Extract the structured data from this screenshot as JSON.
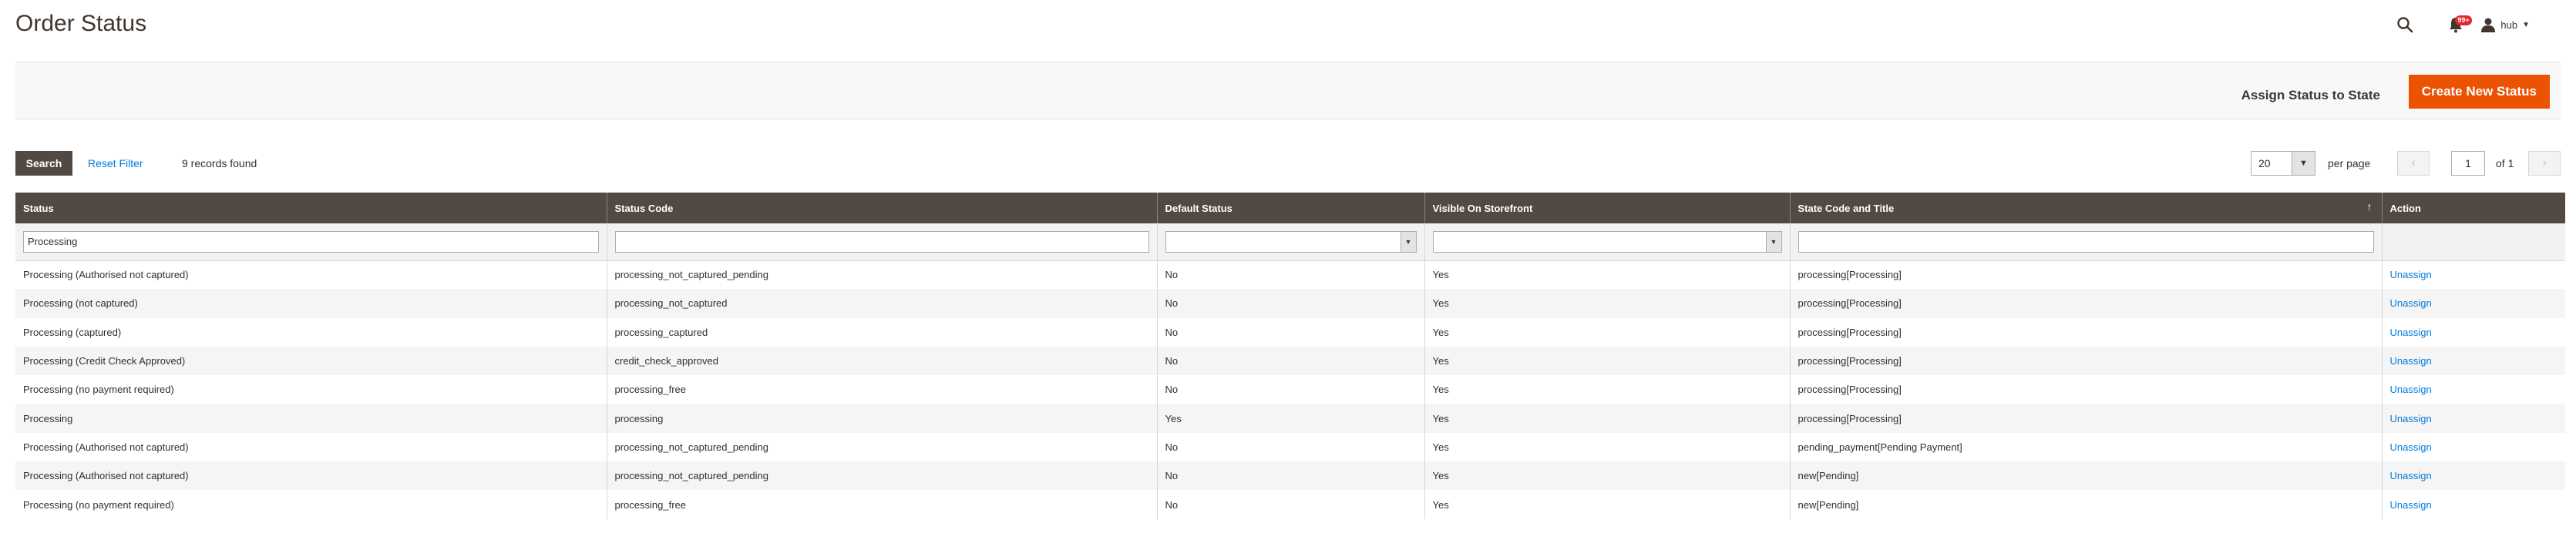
{
  "page": {
    "title": "Order Status"
  },
  "header": {
    "user_name": "hub",
    "notifications_count": "99+"
  },
  "actions": {
    "assign_label": "Assign Status to State",
    "create_label": "Create New Status"
  },
  "toolbar": {
    "search_label": "Search",
    "reset_label": "Reset Filter",
    "records_found": "9 records found",
    "per_page_value": "20",
    "per_page_label": "per page",
    "page_current": "1",
    "page_total_label": "of 1"
  },
  "columns": [
    "Status",
    "Status Code",
    "Default Status",
    "Visible On Storefront",
    "State Code and Title",
    "Action"
  ],
  "filters": {
    "status": "Processing",
    "status_code": "",
    "default_status": "",
    "visible_on_storefront": "",
    "state_code": ""
  },
  "rows": [
    [
      "Processing (Authorised not captured)",
      "processing_not_captured_pending",
      "No",
      "Yes",
      "processing[Processing]",
      "Unassign"
    ],
    [
      "Processing (not captured)",
      "processing_not_captured",
      "No",
      "Yes",
      "processing[Processing]",
      "Unassign"
    ],
    [
      "Processing (captured)",
      "processing_captured",
      "No",
      "Yes",
      "processing[Processing]",
      "Unassign"
    ],
    [
      "Processing (Credit Check Approved)",
      "credit_check_approved",
      "No",
      "Yes",
      "processing[Processing]",
      "Unassign"
    ],
    [
      "Processing (no payment required)",
      "processing_free",
      "No",
      "Yes",
      "processing[Processing]",
      "Unassign"
    ],
    [
      "Processing",
      "processing",
      "Yes",
      "Yes",
      "processing[Processing]",
      "Unassign"
    ],
    [
      "Processing (Authorised not captured)",
      "processing_not_captured_pending",
      "No",
      "Yes",
      "pending_payment[Pending Payment]",
      "Unassign"
    ],
    [
      "Processing (Authorised not captured)",
      "processing_not_captured_pending",
      "No",
      "Yes",
      "new[Pending]",
      "Unassign"
    ],
    [
      "Processing (no payment required)",
      "processing_free",
      "No",
      "Yes",
      "new[Pending]",
      "Unassign"
    ]
  ],
  "colors": {
    "header_bg": "#514943",
    "primary": "#eb5202",
    "link": "#007bdb"
  }
}
